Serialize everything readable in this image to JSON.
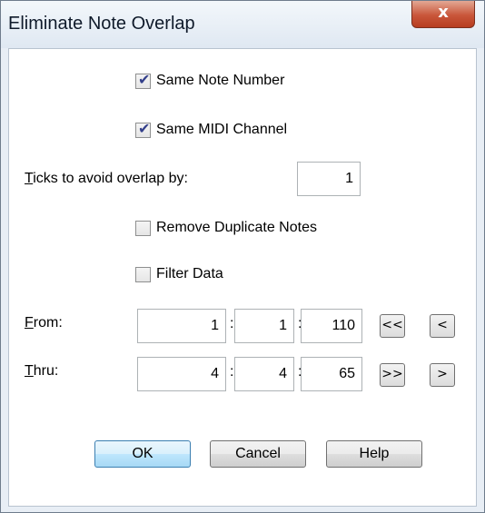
{
  "window": {
    "title": "Eliminate Note Overlap",
    "close_symbol": "x"
  },
  "options": {
    "same_note_number": {
      "label": "Same Note Number",
      "checked": true
    },
    "same_midi_channel": {
      "label": "Same MIDI Channel",
      "checked": true
    },
    "remove_duplicate_notes": {
      "label": "Remove Duplicate Notes",
      "checked": false
    },
    "filter_data": {
      "label": "Filter Data",
      "checked": false
    }
  },
  "ticks": {
    "label_mnemonic": "T",
    "label_rest": "icks to avoid overlap by:",
    "value": "1"
  },
  "from": {
    "label_mnemonic": "F",
    "label_rest": "rom:",
    "bar": "1",
    "beat": "1",
    "tick": "110",
    "first_button": "<<",
    "prev_button": "<"
  },
  "thru": {
    "label_mnemonic": "T",
    "label_rest": "hru:",
    "bar": "4",
    "beat": "4",
    "tick": "65",
    "last_button": ">>",
    "next_button": ">"
  },
  "separator": ":",
  "buttons": {
    "ok": "OK",
    "cancel": "Cancel",
    "help": "Help"
  },
  "icons": {
    "check": "check-icon",
    "close": "close-icon"
  }
}
